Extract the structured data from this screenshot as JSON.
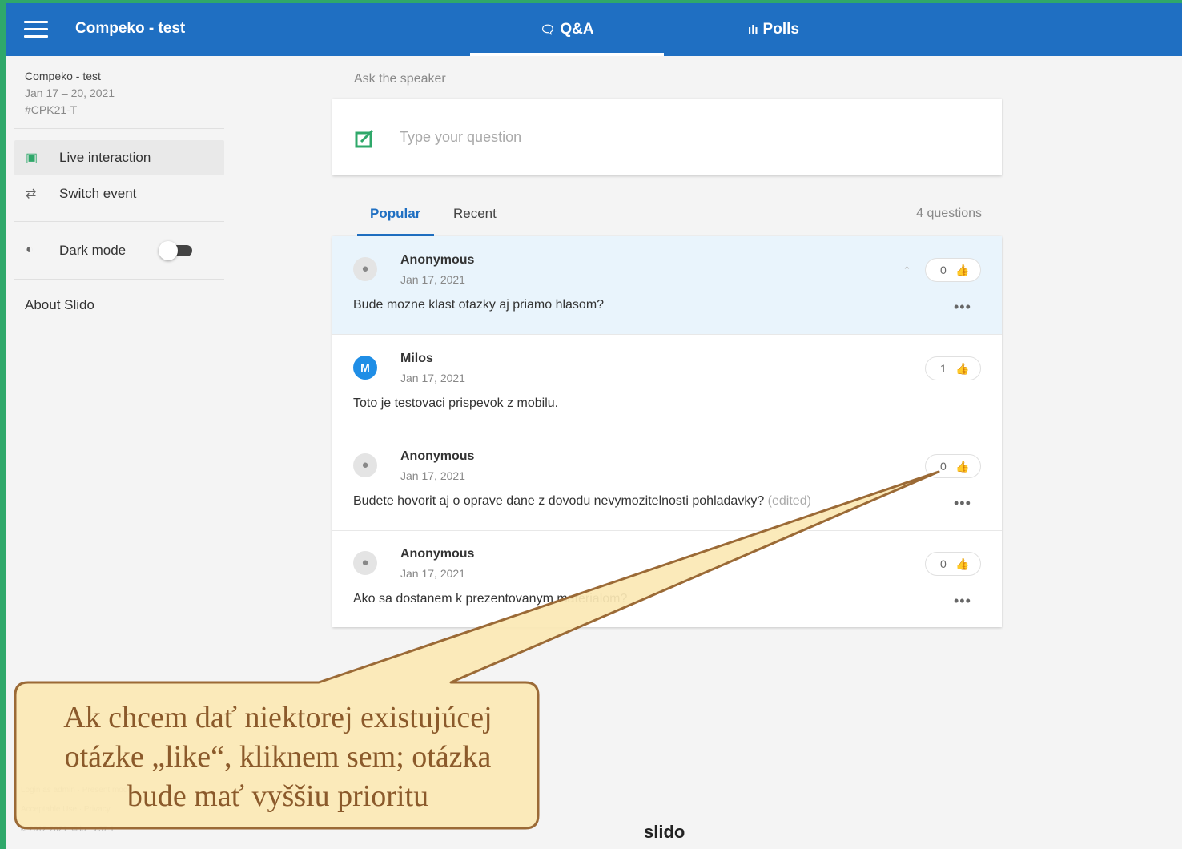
{
  "header": {
    "title": "Compeko - test",
    "tabs": [
      {
        "icon": "chat-icon",
        "label": "Q&A"
      },
      {
        "icon": "bar-chart-icon",
        "label": "Polls"
      }
    ]
  },
  "sidebar": {
    "event_name": "Compeko - test",
    "event_dates": "Jan 17 – 20, 2021",
    "event_code": "#CPK21-T",
    "items": [
      {
        "icon": "live-interaction-icon",
        "label": "Live interaction"
      },
      {
        "icon": "switch-icon",
        "label": "Switch event"
      }
    ],
    "dark_mode_label": "Dark mode",
    "dark_mode_on": false,
    "about_label": "About Slido",
    "footer": [
      "Login as admin · Present mode",
      "Acceptable Use · Privacy",
      "© 2012-2021 slido - v.37.1"
    ]
  },
  "qa": {
    "ask_label": "Ask the speaker",
    "input_placeholder": "Type your question",
    "tabs": [
      "Popular",
      "Recent"
    ],
    "count": "4 questions",
    "questions": [
      {
        "author": "Anonymous",
        "date": "Jan 17, 2021",
        "text": "Bude mozne klast otazky aj priamo hlasom?",
        "likes": "0",
        "highlighted": true,
        "avatar": "user-icon"
      },
      {
        "author": "Milos",
        "date": "Jan 17, 2021",
        "text": "Toto je testovaci prispevok z mobilu.",
        "likes": "1",
        "highlighted": false,
        "avatar_letter": "M"
      },
      {
        "author": "Anonymous",
        "date": "Jan 17, 2021",
        "text": "Budete hovorit aj o oprave dane z dovodu nevymozitelnosti pohladavky?",
        "suffix": "(edited)",
        "likes": "0",
        "highlighted": false,
        "avatar": "user-icon"
      },
      {
        "author": "Anonymous",
        "date": "Jan 17, 2021",
        "text": "Ako sa dostanem k prezentovanym materialom?",
        "likes": "0",
        "highlighted": false,
        "avatar": "user-icon"
      }
    ],
    "more_label": "•••"
  },
  "brand": "slido",
  "callout": {
    "lines": [
      "Ak chcem dať niektorej existujúcej",
      "otázke „like“, kliknem sem; otázka",
      "bude mať vyššiu prioritu"
    ],
    "fill": "#fbe8b5",
    "border": "#9b6a36"
  },
  "colors": {
    "primary": "#1f6fc2",
    "accent_green": "#2fa86a",
    "highlight": "#e9f4fc"
  }
}
